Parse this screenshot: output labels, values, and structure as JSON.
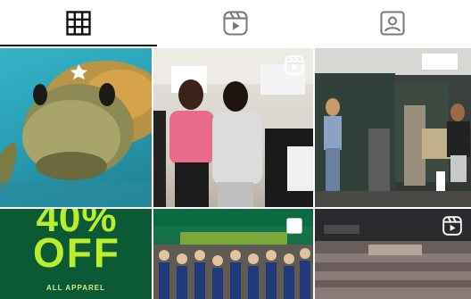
{
  "tabs": [
    {
      "icon": "grid-icon",
      "active": true
    },
    {
      "icon": "reels-icon",
      "active": false
    },
    {
      "icon": "tagged-icon",
      "active": false
    }
  ],
  "posts": [
    {
      "kind": "photo",
      "subject": "sea turtle"
    },
    {
      "kind": "reel",
      "subject": "students reacting"
    },
    {
      "kind": "photo",
      "subject": "hallway gym"
    },
    {
      "kind": "photo",
      "promo_headline_top": "40%",
      "promo_headline": "OFF",
      "promo_sub": "ALL APPAREL"
    },
    {
      "kind": "photo",
      "subject": "group photo"
    },
    {
      "kind": "reel",
      "subject": "gym crowd"
    }
  ],
  "colors": {
    "accent_dark": "#111111",
    "promo_green": "#0c5a35",
    "promo_lime": "#b8ee2c"
  }
}
